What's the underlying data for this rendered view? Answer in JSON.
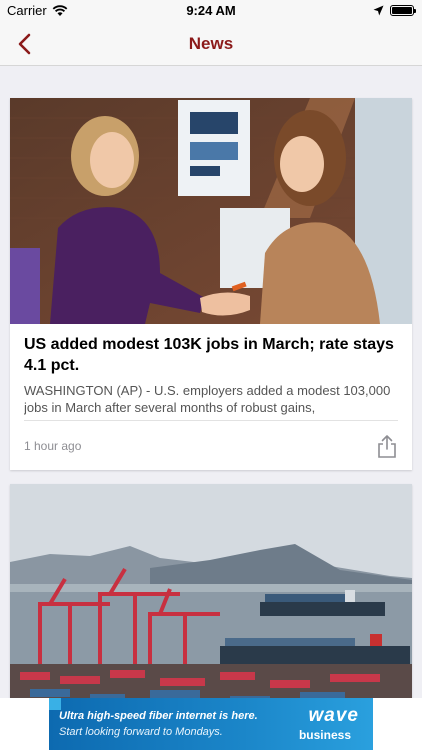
{
  "status_bar": {
    "carrier": "Carrier",
    "time": "9:24 AM"
  },
  "nav": {
    "title": "News"
  },
  "articles": [
    {
      "headline": "US added modest 103K jobs in March; rate stays 4.1 pct.",
      "summary": "WASHINGTON (AP) - U.S. employers added a modest 103,000 jobs in March after several months of robust gains,",
      "timestamp": "1 hour ago"
    },
    {}
  ],
  "ad": {
    "line1": "Ultra high-speed fiber internet is here.",
    "line2": "Start looking forward to Mondays.",
    "brand": "wave",
    "brand_sub": "business"
  },
  "colors": {
    "accent": "#8b1a1a",
    "background": "#efeff4"
  }
}
